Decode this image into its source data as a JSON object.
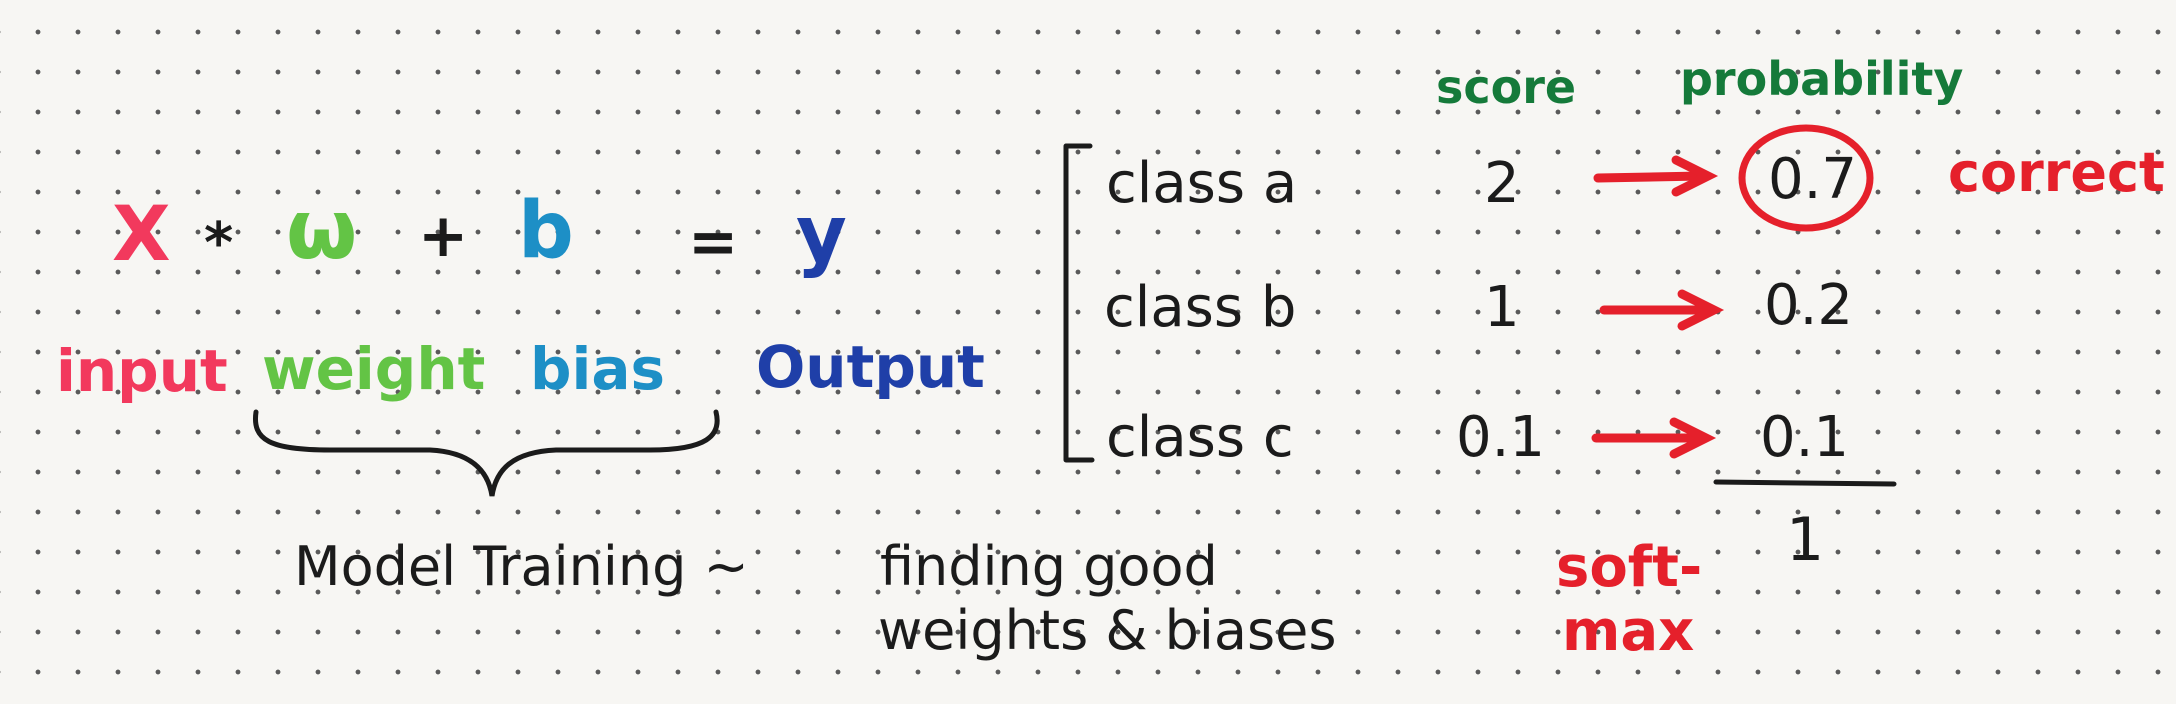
{
  "colors": {
    "ink": "#1b1b1b",
    "red": "#e5202b",
    "pink": "#f2395d",
    "light_green": "#63c445",
    "dark_green": "#157a3a",
    "teal": "#1d8fc6",
    "navy": "#1f3fa8"
  },
  "equation": {
    "x": "X",
    "times": "*",
    "w": "ω",
    "plus": "+",
    "b": "b",
    "equals": "=",
    "y": "y"
  },
  "labels": {
    "input": "input",
    "weight": "weight",
    "bias": "bias",
    "output": "Output"
  },
  "model_training": {
    "left": "Model Training ~",
    "line1": "finding good",
    "line2": "weights & biases"
  },
  "headers": {
    "score": "score",
    "probability": "probability"
  },
  "classes": [
    {
      "name": "class a",
      "score": "2",
      "probability": "0.7"
    },
    {
      "name": "class b",
      "score": "1",
      "probability": "0.2"
    },
    {
      "name": "class c",
      "score": "0.1",
      "probability": "0.1"
    }
  ],
  "correct_label": "correct",
  "softmax": {
    "line1": "soft-",
    "line2": "max"
  },
  "probability_sum": "1",
  "icons": [
    "curly-brace-icon",
    "bracket-icon",
    "arrow-icon",
    "circle-mark-icon",
    "sum-line-icon"
  ]
}
